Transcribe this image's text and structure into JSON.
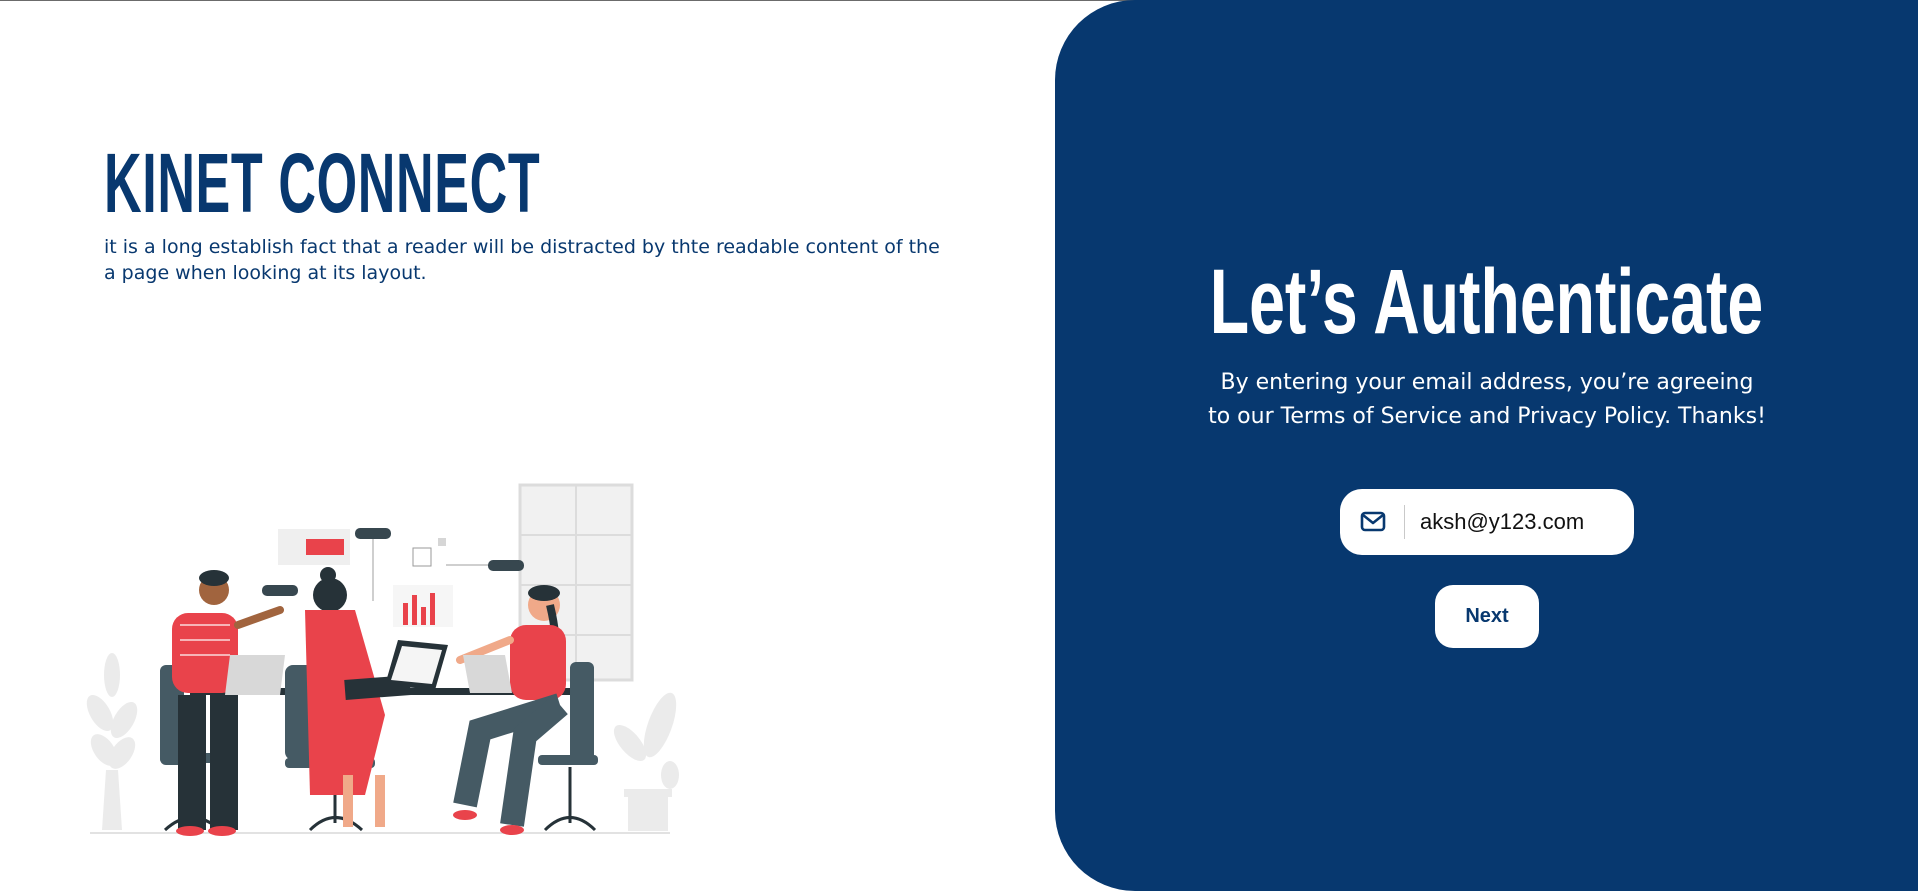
{
  "brand": {
    "title": "KINET CONNECT",
    "tagline": "it is a long establish fact that a reader will be distracted by thte readable content of the a page when looking at its layout."
  },
  "auth": {
    "title": "Let’s Authenticate",
    "description": "By entering your email address, you’re agreeing to our Terms of Service and Privacy Policy. Thanks!",
    "email_value": "aksh@y123.com",
    "email_icon": "envelope-icon",
    "next_label": "Next"
  },
  "colors": {
    "primary": "#07386f",
    "accent": "#e9434b",
    "white": "#ffffff"
  }
}
